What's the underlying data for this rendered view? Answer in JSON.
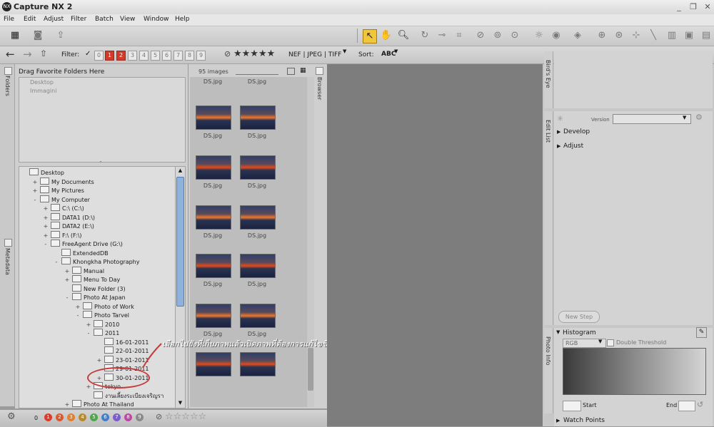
{
  "app": {
    "title": "Capture NX 2",
    "logo": "NX"
  },
  "window_buttons": {
    "minimize": "_",
    "maximize": "❐",
    "close": "✕"
  },
  "menu": [
    "File",
    "Edit",
    "Adjust",
    "Filter",
    "Batch",
    "View",
    "Window",
    "Help"
  ],
  "toolbar2": {
    "filter_label": "Filter:",
    "rating_numbers": [
      "0",
      "1",
      "2",
      "3",
      "4",
      "5",
      "6",
      "7",
      "8",
      "9"
    ],
    "stars": "★★★★★",
    "file_types": "NEF | JPEG | TIFF",
    "sort_label": "Sort:",
    "sort_value": "ABC"
  },
  "folders_tab": "Folders",
  "metadata_tab": "Metadata",
  "favorites_title": "Drag Favorite Folders Here",
  "favorites": [
    "Desktop",
    "Immagini"
  ],
  "tree": [
    {
      "label": "Desktop",
      "level": 0,
      "exp": ""
    },
    {
      "label": "My Documents",
      "level": 1,
      "exp": "+"
    },
    {
      "label": "My Pictures",
      "level": 1,
      "exp": "+"
    },
    {
      "label": "My Computer",
      "level": 1,
      "exp": "-"
    },
    {
      "label": "C:\\ (C:\\)",
      "level": 2,
      "exp": "+"
    },
    {
      "label": "DATA1 (D:\\)",
      "level": 2,
      "exp": "+"
    },
    {
      "label": "DATA2 (E:\\)",
      "level": 2,
      "exp": "+"
    },
    {
      "label": "F:\\ (F:\\)",
      "level": 2,
      "exp": "+"
    },
    {
      "label": "FreeAgent Drive (G:\\)",
      "level": 2,
      "exp": "-"
    },
    {
      "label": "ExtendedDB",
      "level": 3,
      "exp": ""
    },
    {
      "label": "Khongkha Photography",
      "level": 3,
      "exp": "-"
    },
    {
      "label": "Manual",
      "level": 4,
      "exp": "+"
    },
    {
      "label": "Menu To Day",
      "level": 4,
      "exp": "+"
    },
    {
      "label": "New Folder (3)",
      "level": 4,
      "exp": ""
    },
    {
      "label": "Photo At Japan",
      "level": 4,
      "exp": "-"
    },
    {
      "label": "Photo of Work",
      "level": 5,
      "exp": "+"
    },
    {
      "label": "Photo Tarvel",
      "level": 5,
      "exp": "-"
    },
    {
      "label": "2010",
      "level": 6,
      "exp": "+"
    },
    {
      "label": "2011",
      "level": 6,
      "exp": "-"
    },
    {
      "label": "16-01-2011",
      "level": 7,
      "exp": ""
    },
    {
      "label": "22-01-2011",
      "level": 7,
      "exp": ""
    },
    {
      "label": "23-01-2011",
      "level": 7,
      "exp": "+"
    },
    {
      "label": "29-01-2011",
      "level": 7,
      "exp": ""
    },
    {
      "label": "30-01-2011",
      "level": 7,
      "exp": "+"
    },
    {
      "label": "tokyo",
      "level": 6,
      "exp": "+"
    },
    {
      "label": "งานเลี้ยงระเบียงเจริญรา",
      "level": 6,
      "exp": ""
    },
    {
      "label": "Photo At Thailand",
      "level": 4,
      "exp": "+"
    }
  ],
  "browser": {
    "count": "95 images",
    "tab": "Browser",
    "thumb_label": "DS.jpg"
  },
  "annotation": "เลือกไปยังที่เก็บภาพแล้วเปิดภาพที่ต้องการแก้ไขขึ้นมา",
  "right_panel": {
    "birds_eye_tab": "Bird's Eye",
    "edit_list_tab": "Edit List",
    "photo_info_tab": "Photo Info",
    "version_label": "Version",
    "develop": "Develop",
    "adjust": "Adjust",
    "new_step": "New Step",
    "histogram": "Histogram",
    "channel": "RGB",
    "double_threshold": "Double Threshold",
    "start": "Start",
    "end": "End",
    "watch_points": "Watch Points"
  },
  "status": {
    "numbers": [
      "0",
      "1",
      "2",
      "3",
      "4",
      "5",
      "6",
      "7",
      "8",
      "9"
    ],
    "dot_colors": [
      "#e03a2b",
      "#e0572b",
      "#e87d2a",
      "#b98a2a",
      "#4aa94a",
      "#3f7fd0",
      "#7b5bd1",
      "#c244a9",
      "#8a8a8a"
    ],
    "stars": "☆☆☆☆☆"
  }
}
